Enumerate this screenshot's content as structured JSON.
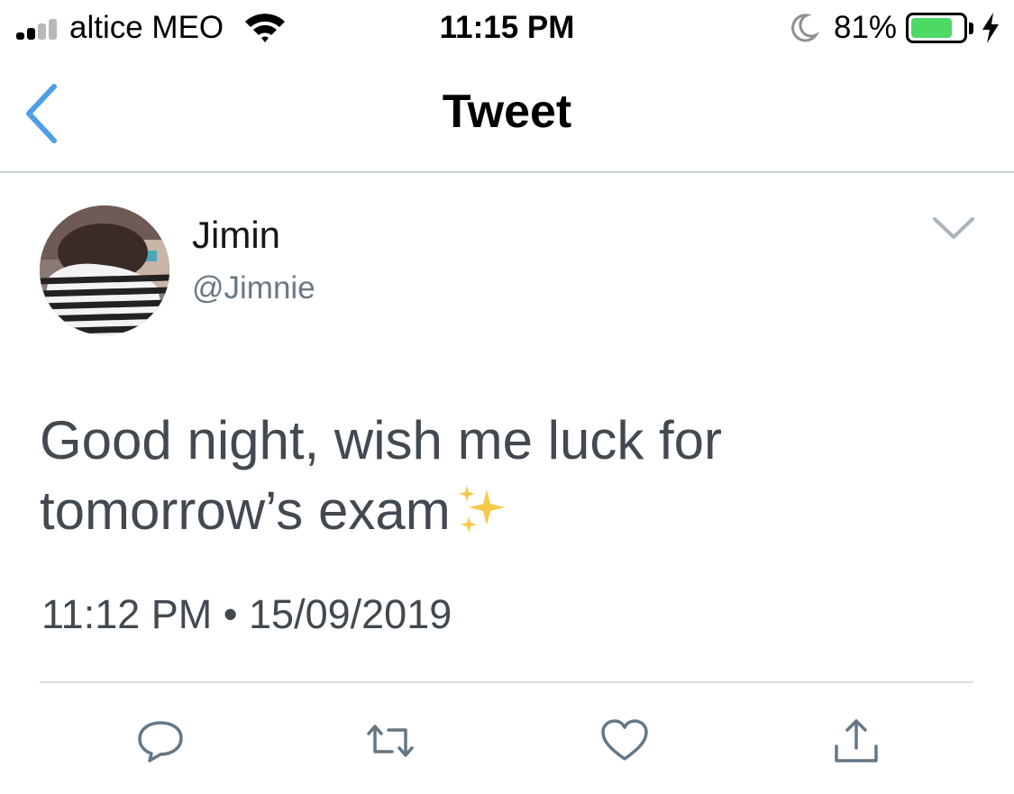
{
  "status_bar": {
    "carrier": "altice MEO",
    "time": "11:15 PM",
    "battery_percent": "81%",
    "battery_level": 0.81,
    "signal_bars_active": 2,
    "signal_bars_total": 4,
    "icons": [
      "signal-icon",
      "wifi-icon",
      "moon-icon",
      "battery-icon",
      "charging-bolt-icon"
    ],
    "battery_color": "#4cd964"
  },
  "nav": {
    "title": "Tweet",
    "back_icon": "chevron-left-icon",
    "accent_color": "#4e9ee8"
  },
  "tweet": {
    "author_name": "Jimin",
    "author_handle": "@Jimnie",
    "text": "Good night, wish me luck for tomorrow’s exam",
    "emoji": "✨",
    "timestamp": "11:12 PM • 15/09/2019",
    "menu_icon": "chevron-down-icon"
  },
  "actions": [
    {
      "name": "reply",
      "icon": "reply-icon"
    },
    {
      "name": "retweet",
      "icon": "retweet-icon"
    },
    {
      "name": "like",
      "icon": "heart-icon"
    },
    {
      "name": "share",
      "icon": "share-icon"
    }
  ],
  "colors": {
    "text_primary": "#14171a",
    "text_secondary": "#697986",
    "action_icon": "#657786"
  }
}
